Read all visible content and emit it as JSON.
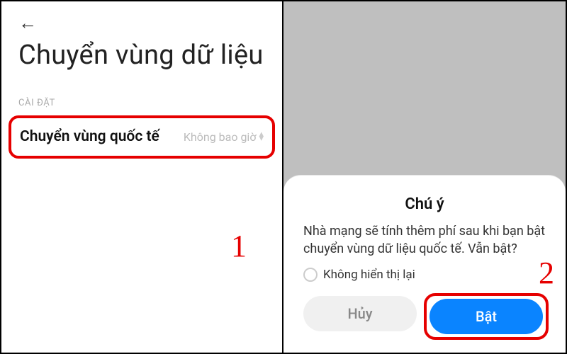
{
  "left": {
    "title": "Chuyển vùng dữ liệu",
    "section_label": "CÀI ĐẶT",
    "row": {
      "label": "Chuyển vùng quốc tế",
      "value": "Không bao giờ"
    },
    "step": "1"
  },
  "right": {
    "dialog": {
      "title": "Chú ý",
      "message": "Nhà mạng sẽ tính thêm phí sau khi bạn bật chuyển vùng dữ liệu quốc tế. Vẫn bật?",
      "checkbox_label": "Không hiển thị lại",
      "cancel": "Hủy",
      "confirm": "Bật"
    },
    "step": "2"
  },
  "colors": {
    "highlight": "#e60000",
    "primary": "#0a84ff"
  }
}
